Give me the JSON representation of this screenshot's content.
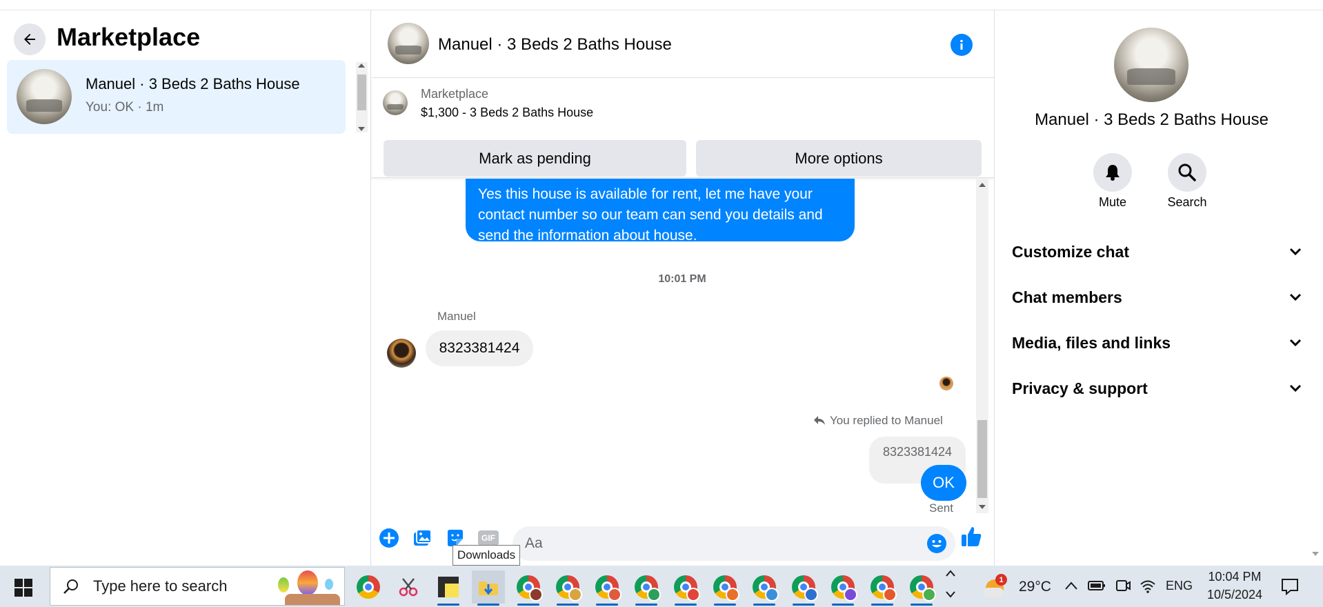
{
  "left_panel": {
    "title": "Marketplace",
    "conversation": {
      "name": "Manuel · 3 Beds 2 Baths House",
      "preview": "You: OK · 1m"
    }
  },
  "chat": {
    "header_title": "Manuel · 3 Beds 2 Baths House",
    "listing": {
      "label": "Marketplace",
      "title": "$1,300 - 3 Beds 2 Baths House",
      "mark_pending": "Mark as pending",
      "more_options": "More options"
    },
    "messages": {
      "outgoing_long": "Yes this house is  available for rent, let me have your contact number so our team can send you details and send the information about house.",
      "timestamp": "10:01 PM",
      "sender_name": "Manuel",
      "incoming_number": "8323381424",
      "reply_note": "You replied to Manuel",
      "quoted_number": "8323381424",
      "outgoing_ok": "OK",
      "status": "Sent"
    },
    "composer": {
      "placeholder": "Aa",
      "gif_label": "GIF"
    },
    "tooltip": "Downloads"
  },
  "right_panel": {
    "title": "Manuel · 3 Beds 2 Baths House",
    "mute_label": "Mute",
    "search_label": "Search",
    "sections": [
      {
        "label": "Customize chat"
      },
      {
        "label": "Chat members"
      },
      {
        "label": "Media, files and links"
      },
      {
        "label": "Privacy & support"
      }
    ]
  },
  "taskbar": {
    "search_placeholder": "Type here to search",
    "weather_temp": "29°C",
    "weather_badge": "1",
    "language": "ENG",
    "time": "10:04 PM",
    "date": "10/5/2024"
  },
  "colors": {
    "messenger_blue": "#0084ff",
    "selected_bg": "#e7f3ff",
    "button_gray": "#e4e6eb",
    "taskbar_bg": "#dfe6ee"
  }
}
